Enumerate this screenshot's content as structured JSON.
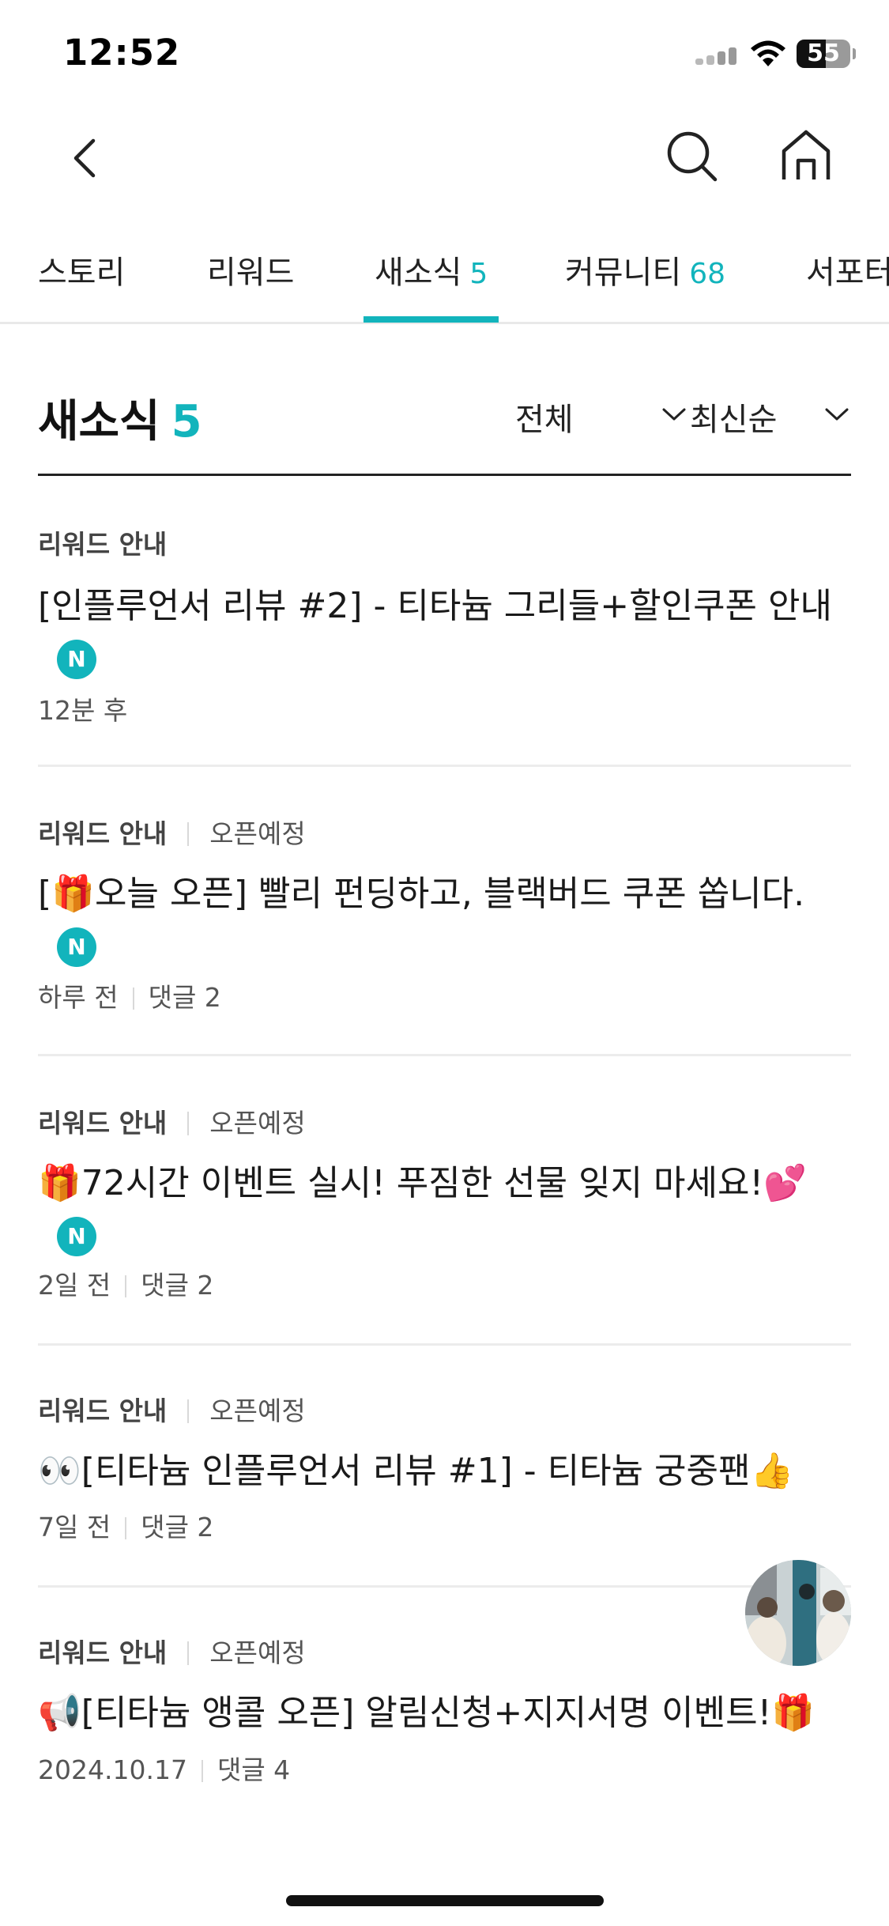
{
  "status_bar": {
    "time": "12:52",
    "battery": "55",
    "battery_level": 0.55
  },
  "tabs": [
    {
      "label": "스토리",
      "count": ""
    },
    {
      "label": "리워드",
      "count": ""
    },
    {
      "label": "새소식",
      "count": "5"
    },
    {
      "label": "커뮤니티",
      "count": "68"
    },
    {
      "label": "서포터",
      "count": ""
    }
  ],
  "active_tab": "새소식",
  "section": {
    "title": "새소식",
    "count": "5"
  },
  "filters": {
    "type": "전체",
    "sort": "최신순"
  },
  "news": [
    {
      "category": "리워드 안내",
      "status": "",
      "title": "[인플루언서 리뷰 #2] - 티타늄 그리들+할인쿠폰 안내",
      "badge": "N",
      "time": "12분 후",
      "comments": ""
    },
    {
      "category": "리워드 안내",
      "status": "오픈예정",
      "title": "[🎁오늘 오픈] 빨리 펀딩하고, 블랙버드 쿠폰 쏩니다.",
      "badge": "N",
      "time": "하루 전",
      "comments": "댓글 2"
    },
    {
      "category": "리워드 안내",
      "status": "오픈예정",
      "title": "🎁72시간 이벤트 실시! 푸짐한 선물 잊지 마세요!💕",
      "badge": "N",
      "time": "2일 전",
      "comments": "댓글 2"
    },
    {
      "category": "리워드 안내",
      "status": "오픈예정",
      "title": "👀[티타늄 인플루언서 리뷰 #1] - 티타늄 궁중팬👍",
      "badge": "",
      "time": "7일 전",
      "comments": "댓글 2"
    },
    {
      "category": "리워드 안내",
      "status": "오픈예정",
      "title": "📢[티타늄 앵콜 오픈] 알림신청+지지서명 이벤트!🎁",
      "badge": "",
      "time": "2024.10.17",
      "comments": "댓글 4"
    }
  ],
  "icons": {
    "back": "chevron-left-icon",
    "search": "search-icon",
    "home": "home-icon",
    "dropdown": "chevron-down-icon"
  },
  "colors": {
    "accent": "#12b4bc",
    "text": "#1a1a1a",
    "muted": "#555555"
  }
}
